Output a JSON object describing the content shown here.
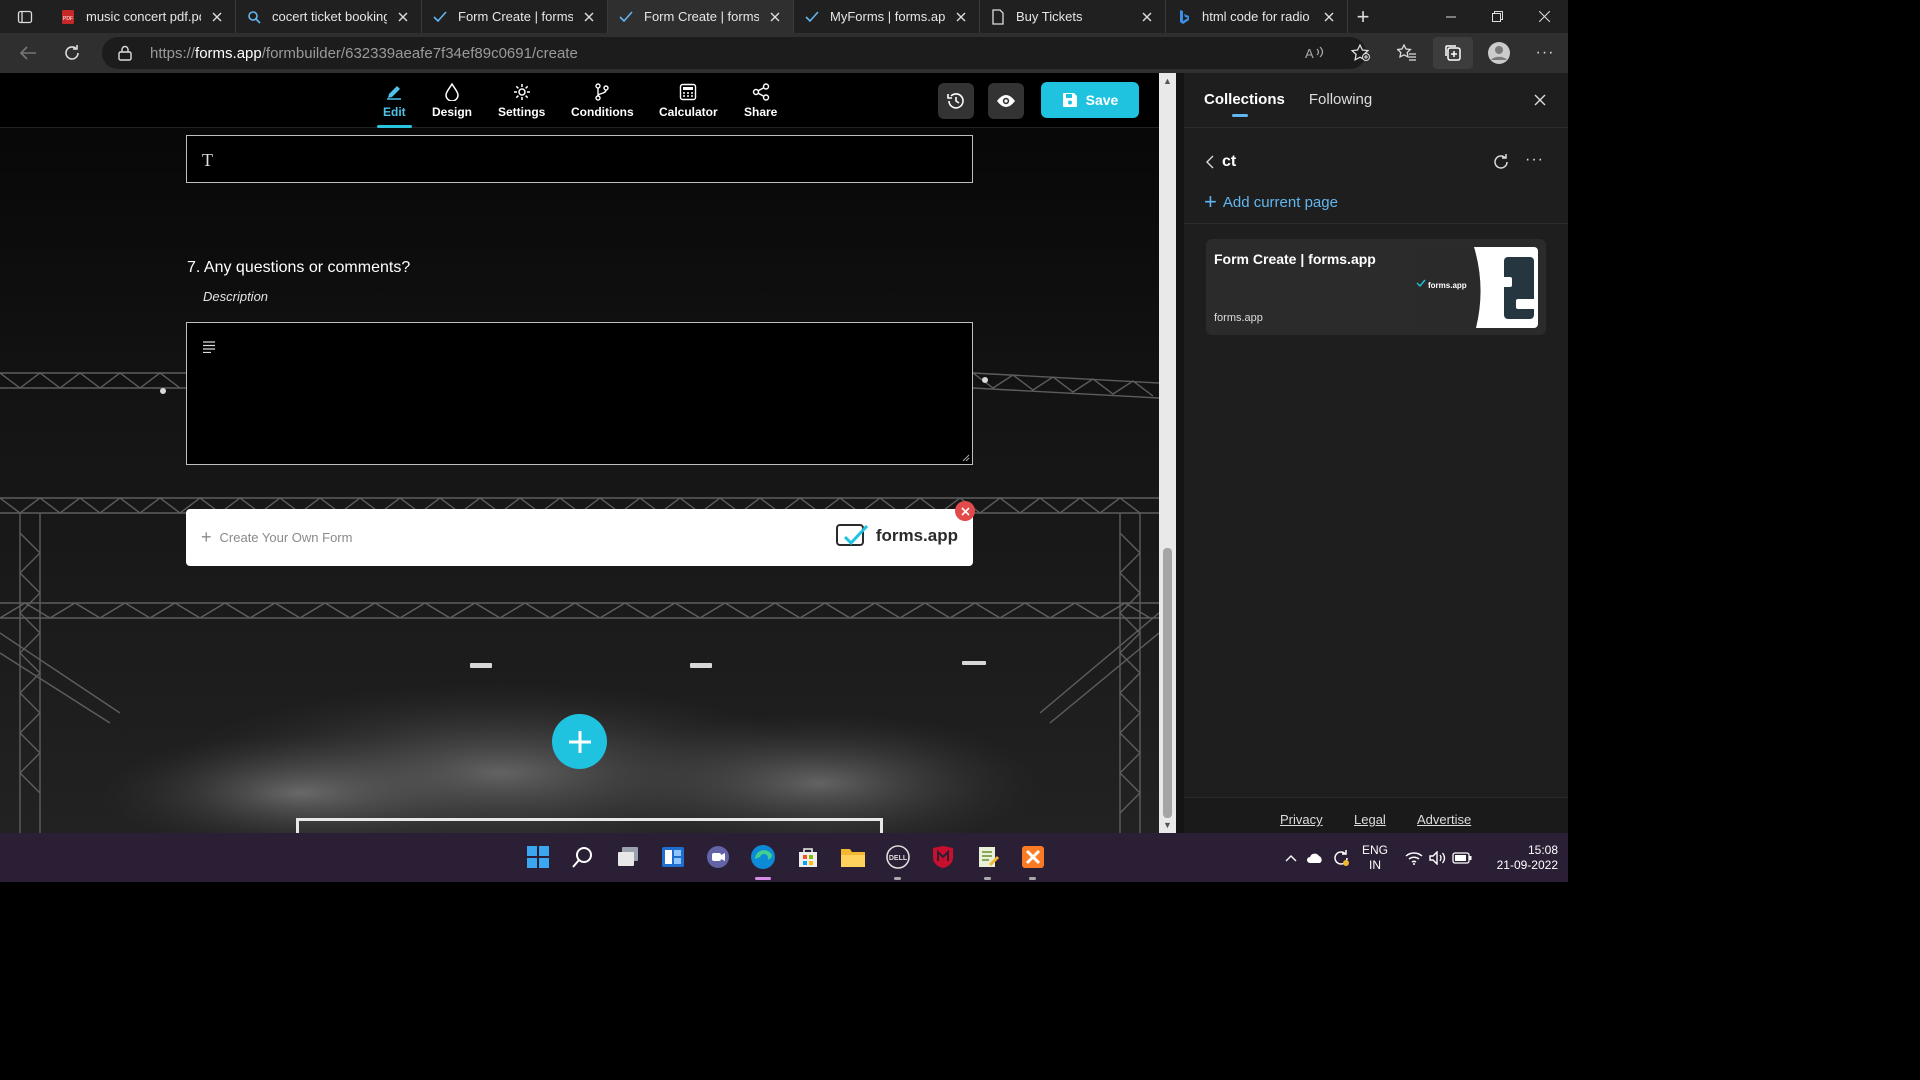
{
  "browser": {
    "tabs": [
      {
        "title": "music concert pdf.pdf",
        "icon": "pdf-icon",
        "active": false
      },
      {
        "title": "cocert ticket booking",
        "icon": "search-icon",
        "active": false
      },
      {
        "title": "Form Create | forms.a",
        "icon": "forms-app-icon",
        "active": false
      },
      {
        "title": "Form Create | forms.a",
        "icon": "forms-app-icon",
        "active": true
      },
      {
        "title": "MyForms | forms.app",
        "icon": "forms-app-icon",
        "active": false
      },
      {
        "title": "Buy Tickets",
        "icon": "page-icon",
        "active": false
      },
      {
        "title": "html code for radio bu",
        "icon": "bing-icon",
        "active": false
      }
    ],
    "url": {
      "scheme": "https://",
      "host": "forms.app",
      "path": "/formbuilder/632339aeafe7f34ef89c0691/create"
    }
  },
  "builder": {
    "tools": [
      {
        "label": "Edit",
        "icon": "pencil-icon",
        "active": true
      },
      {
        "label": "Design",
        "icon": "droplet-icon",
        "active": false
      },
      {
        "label": "Settings",
        "icon": "gear-icon",
        "active": false
      },
      {
        "label": "Conditions",
        "icon": "branch-icon",
        "active": false
      },
      {
        "label": "Calculator",
        "icon": "calculator-icon",
        "active": false
      },
      {
        "label": "Share",
        "icon": "share-icon",
        "active": false
      }
    ],
    "save_label": "Save",
    "text_field_glyph": "T",
    "question": {
      "number": "7.",
      "title": "Any questions or comments?",
      "description": "Description"
    },
    "promo": {
      "text": "Create Your Own Form",
      "brand": "forms.app"
    },
    "accent": "#1fc3df"
  },
  "sidebar": {
    "tabs": [
      {
        "label": "Collections",
        "active": true
      },
      {
        "label": "Following",
        "active": false
      }
    ],
    "collection_name": "ct",
    "add_label": "Add current page",
    "card": {
      "title": "Form Create | forms.app",
      "source": "forms.app",
      "thumb_brand": "forms.app"
    },
    "footer": [
      "Privacy",
      "Legal",
      "Advertise"
    ]
  },
  "taskbar": {
    "lang_top": "ENG",
    "lang_bottom": "IN",
    "time": "15:08",
    "date": "21-09-2022"
  }
}
